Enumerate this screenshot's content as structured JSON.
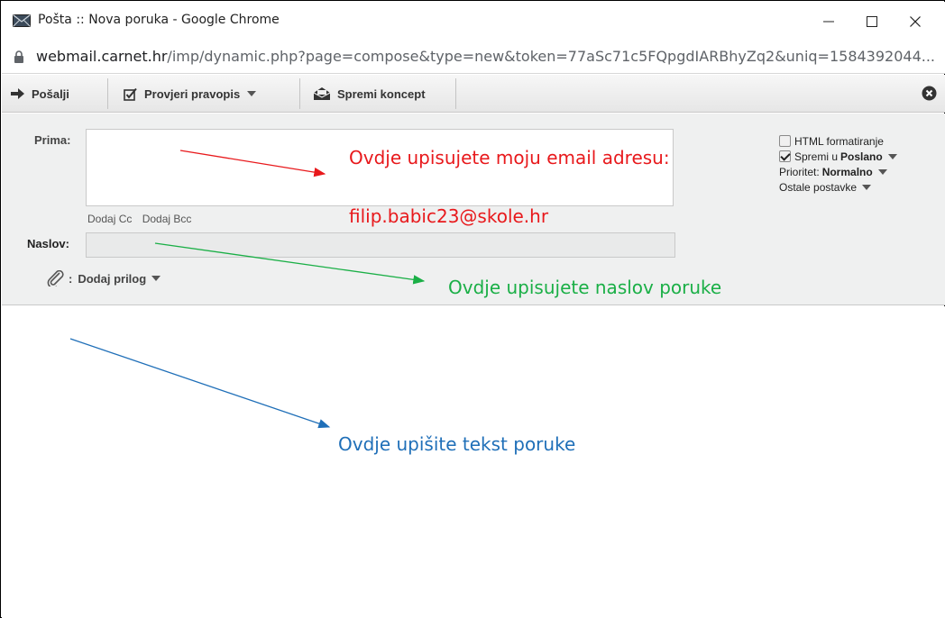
{
  "window": {
    "title": "Pošta :: Nova poruka - Google Chrome",
    "url_host": "webmail.carnet.hr",
    "url_path": "/imp/dynamic.php?page=compose&type=new&token=77aSc71c5FQpgdIARBhyZq2&uniq=1584392044..."
  },
  "toolbar": {
    "send_label": "Pošalji",
    "spellcheck_label": "Provjeri pravopis",
    "save_draft_label": "Spremi koncept"
  },
  "compose": {
    "to_label": "Prima:",
    "to_value": "",
    "add_cc": "Dodaj Cc",
    "add_bcc": "Dodaj Bcc",
    "subject_label": "Naslov:",
    "subject_value": "",
    "attach_colon": ":",
    "attach_label": "Dodaj prilog",
    "body_value": ""
  },
  "options": {
    "html_format": "HTML formatiranje",
    "save_in_prefix": "Spremi u",
    "save_in_folder": "Poslano",
    "priority_prefix": "Prioritet:",
    "priority_value": "Normalno",
    "more_options": "Ostale postavke",
    "html_checked": false,
    "save_checked": true
  },
  "annotations": {
    "to_hint": "Ovdje upisujete moju email adresu:",
    "to_email": "filip.babic23@skole.hr",
    "subject_hint": "Ovdje upisujete naslov poruke",
    "body_hint": "Ovdje upišite tekst poruke",
    "colors": {
      "red": "#e8191c",
      "green": "#1aaf46",
      "blue": "#1f6fb8"
    }
  }
}
